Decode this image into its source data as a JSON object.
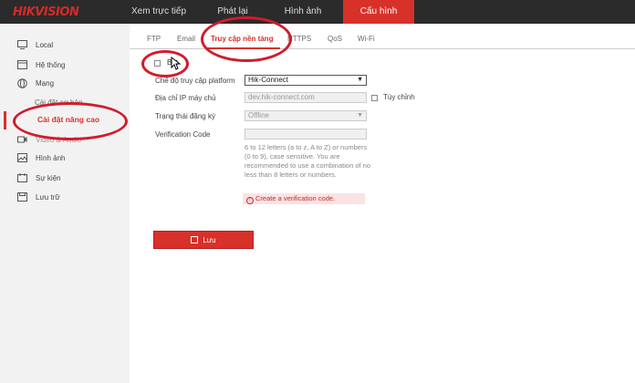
{
  "header": {
    "logo": "HIKVISION",
    "nav": [
      "Xem trực tiếp",
      "Phát lại",
      "Hình ảnh",
      "Cấu hình"
    ]
  },
  "sidebar": {
    "items": [
      {
        "label": "Local",
        "icon": "monitor-icon"
      },
      {
        "label": "Hệ thống",
        "icon": "system-icon"
      },
      {
        "label": "Mạng",
        "icon": "globe-icon"
      },
      {
        "label": "Video & Audio",
        "icon": "video-icon"
      },
      {
        "label": "Hình ảnh",
        "icon": "image-icon"
      },
      {
        "label": "Sự kiện",
        "icon": "calendar-icon"
      },
      {
        "label": "Lưu trữ",
        "icon": "storage-icon"
      }
    ],
    "sub": {
      "basic": "Cài đặt cơ bản",
      "advanced": "Cài đặt nâng cao"
    }
  },
  "tabs": [
    "FTP",
    "Email",
    "Truy cập nền tảng",
    "HTTPS",
    "QoS",
    "Wi-Fi"
  ],
  "form": {
    "enable_label": "Bật",
    "mode_label": "Chế độ truy cập platform",
    "mode_value": "Hik-Connect",
    "server_label": "Địa chỉ IP máy chủ",
    "server_value": "dev.hik-connect.com",
    "custom_label": "Tùy chỉnh",
    "status_label": "Trạng thái đăng ký",
    "status_value": "Offline",
    "code_label": "Verification Code",
    "code_value": "",
    "hint": "6 to 12 letters (a to z, A to Z) or numbers (0 to 9), case sensitive. You are recommended to use a combination of no less than 8 letters or numbers.",
    "error": "Create a verification code.",
    "save": "Lưu"
  },
  "colors": {
    "accent": "#d8312a",
    "annotation": "#d11c2c"
  }
}
